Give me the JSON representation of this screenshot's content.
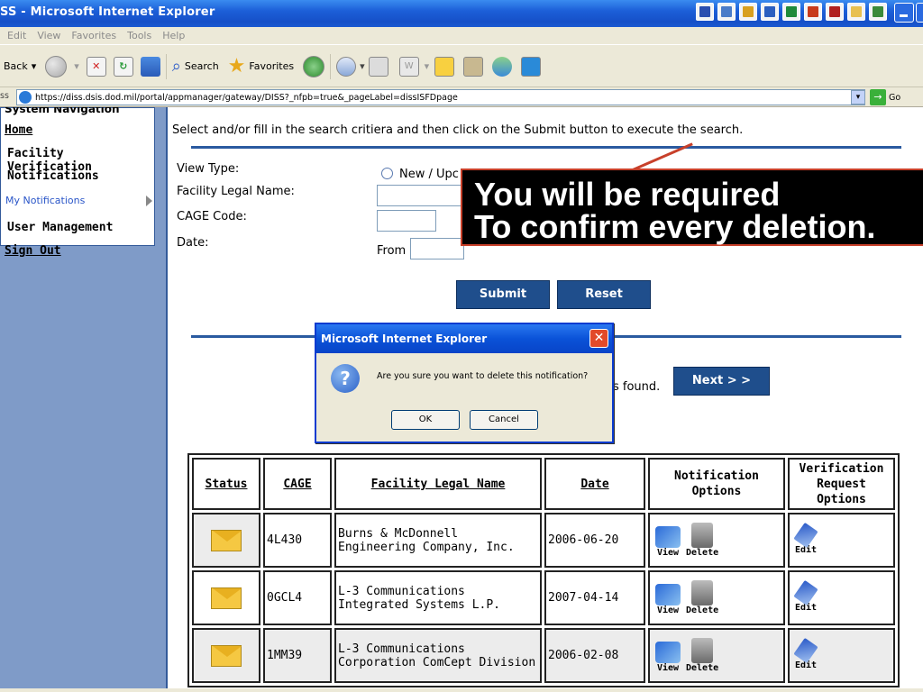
{
  "window": {
    "title": "SS - Microsoft Internet Explorer"
  },
  "menu": [
    "Edit",
    "View",
    "Favorites",
    "Tools",
    "Help"
  ],
  "toolbar": {
    "back": "Back",
    "search": "Search",
    "favorites": "Favorites"
  },
  "address": {
    "label": "ss",
    "url": "https://diss.dsis.dod.mil/portal/appmanager/gateway/DISS?_nfpb=true&_pageLabel=dissISFDpage",
    "go": "Go"
  },
  "nav": {
    "clipped": "System Navigation",
    "home": "Home",
    "facility_verification": "Facility Verification",
    "notifications": "Notifications",
    "my_notifications": "My Notifications",
    "user_management": "User Management",
    "sign_out": "Sign Out"
  },
  "search": {
    "instructions": "Select and/or fill in the search critiera and then click on the Submit button to execute the search.",
    "view_type_label": "View Type:",
    "view_type_option": "New / Upc",
    "legal_name_label": "Facility Legal Name:",
    "cage_label": "CAGE Code:",
    "date_label": "Date:",
    "from_label": "From",
    "submit": "Submit",
    "reset": "Reset"
  },
  "results": {
    "found_suffix": "s found.",
    "next": "Next > >"
  },
  "table": {
    "headers": {
      "status": "Status",
      "cage": "CAGE",
      "name": "Facility Legal Name",
      "date": "Date",
      "notif_options": "Notification Options",
      "verif_options": "Verification Request Options"
    },
    "rows": [
      {
        "cage": "4L430",
        "name": "Burns & McDonnell Engineering Company, Inc.",
        "date": "2006-06-20"
      },
      {
        "cage": "0GCL4",
        "name": "L-3 Communications Integrated Systems L.P.",
        "date": "2007-04-14"
      },
      {
        "cage": "1MM39",
        "name": "L-3 Communications Corporation ComCept Division",
        "date": "2006-02-08"
      }
    ],
    "view_label": "View",
    "delete_label": "Delete",
    "edit_label": "Edit"
  },
  "dialog": {
    "title": "Microsoft Internet Explorer",
    "message": "Are you sure you want to delete this notification?",
    "ok": "OK",
    "cancel": "Cancel"
  },
  "callout": {
    "line1": "You will be required",
    "line2": "To confirm every deletion."
  }
}
